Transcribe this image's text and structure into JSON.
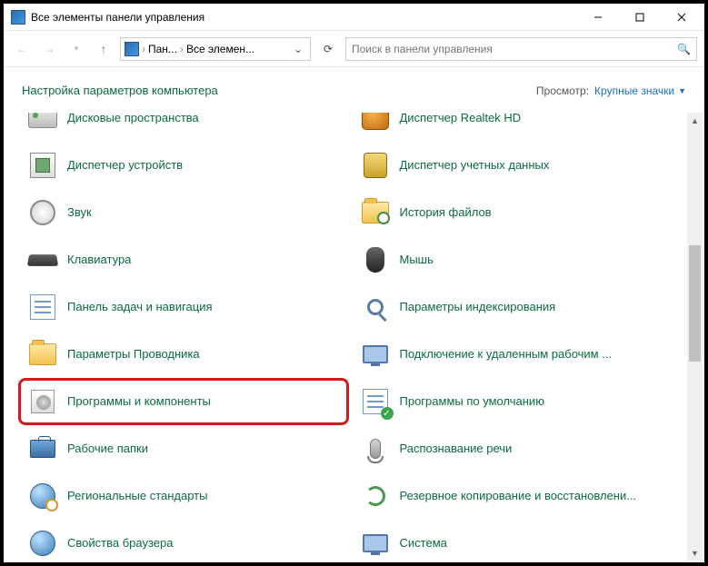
{
  "window": {
    "title": "Все элементы панели управления"
  },
  "breadcrumb": {
    "seg1": "Пан...",
    "seg2": "Все элемен..."
  },
  "search": {
    "placeholder": "Поиск в панели управления"
  },
  "header": {
    "title": "Настройка параметров компьютера",
    "view_label": "Просмотр:",
    "view_value": "Крупные значки"
  },
  "items": {
    "left": [
      "Дисковые пространства",
      "Диспетчер устройств",
      "Звук",
      "Клавиатура",
      "Панель задач и навигация",
      "Параметры Проводника",
      "Программы и компоненты",
      "Рабочие папки",
      "Региональные стандарты",
      "Свойства браузера"
    ],
    "right": [
      "Диспетчер Realtek HD",
      "Диспетчер учетных данных",
      "История файлов",
      "Мышь",
      "Параметры индексирования",
      "Подключение к удаленным рабочим ...",
      "Программы по умолчанию",
      "Распознавание речи",
      "Резервное копирование и восстановлени...",
      "Система"
    ]
  },
  "scrollbar": {
    "thumb_top_pct": 28,
    "thumb_height_pct": 28
  }
}
